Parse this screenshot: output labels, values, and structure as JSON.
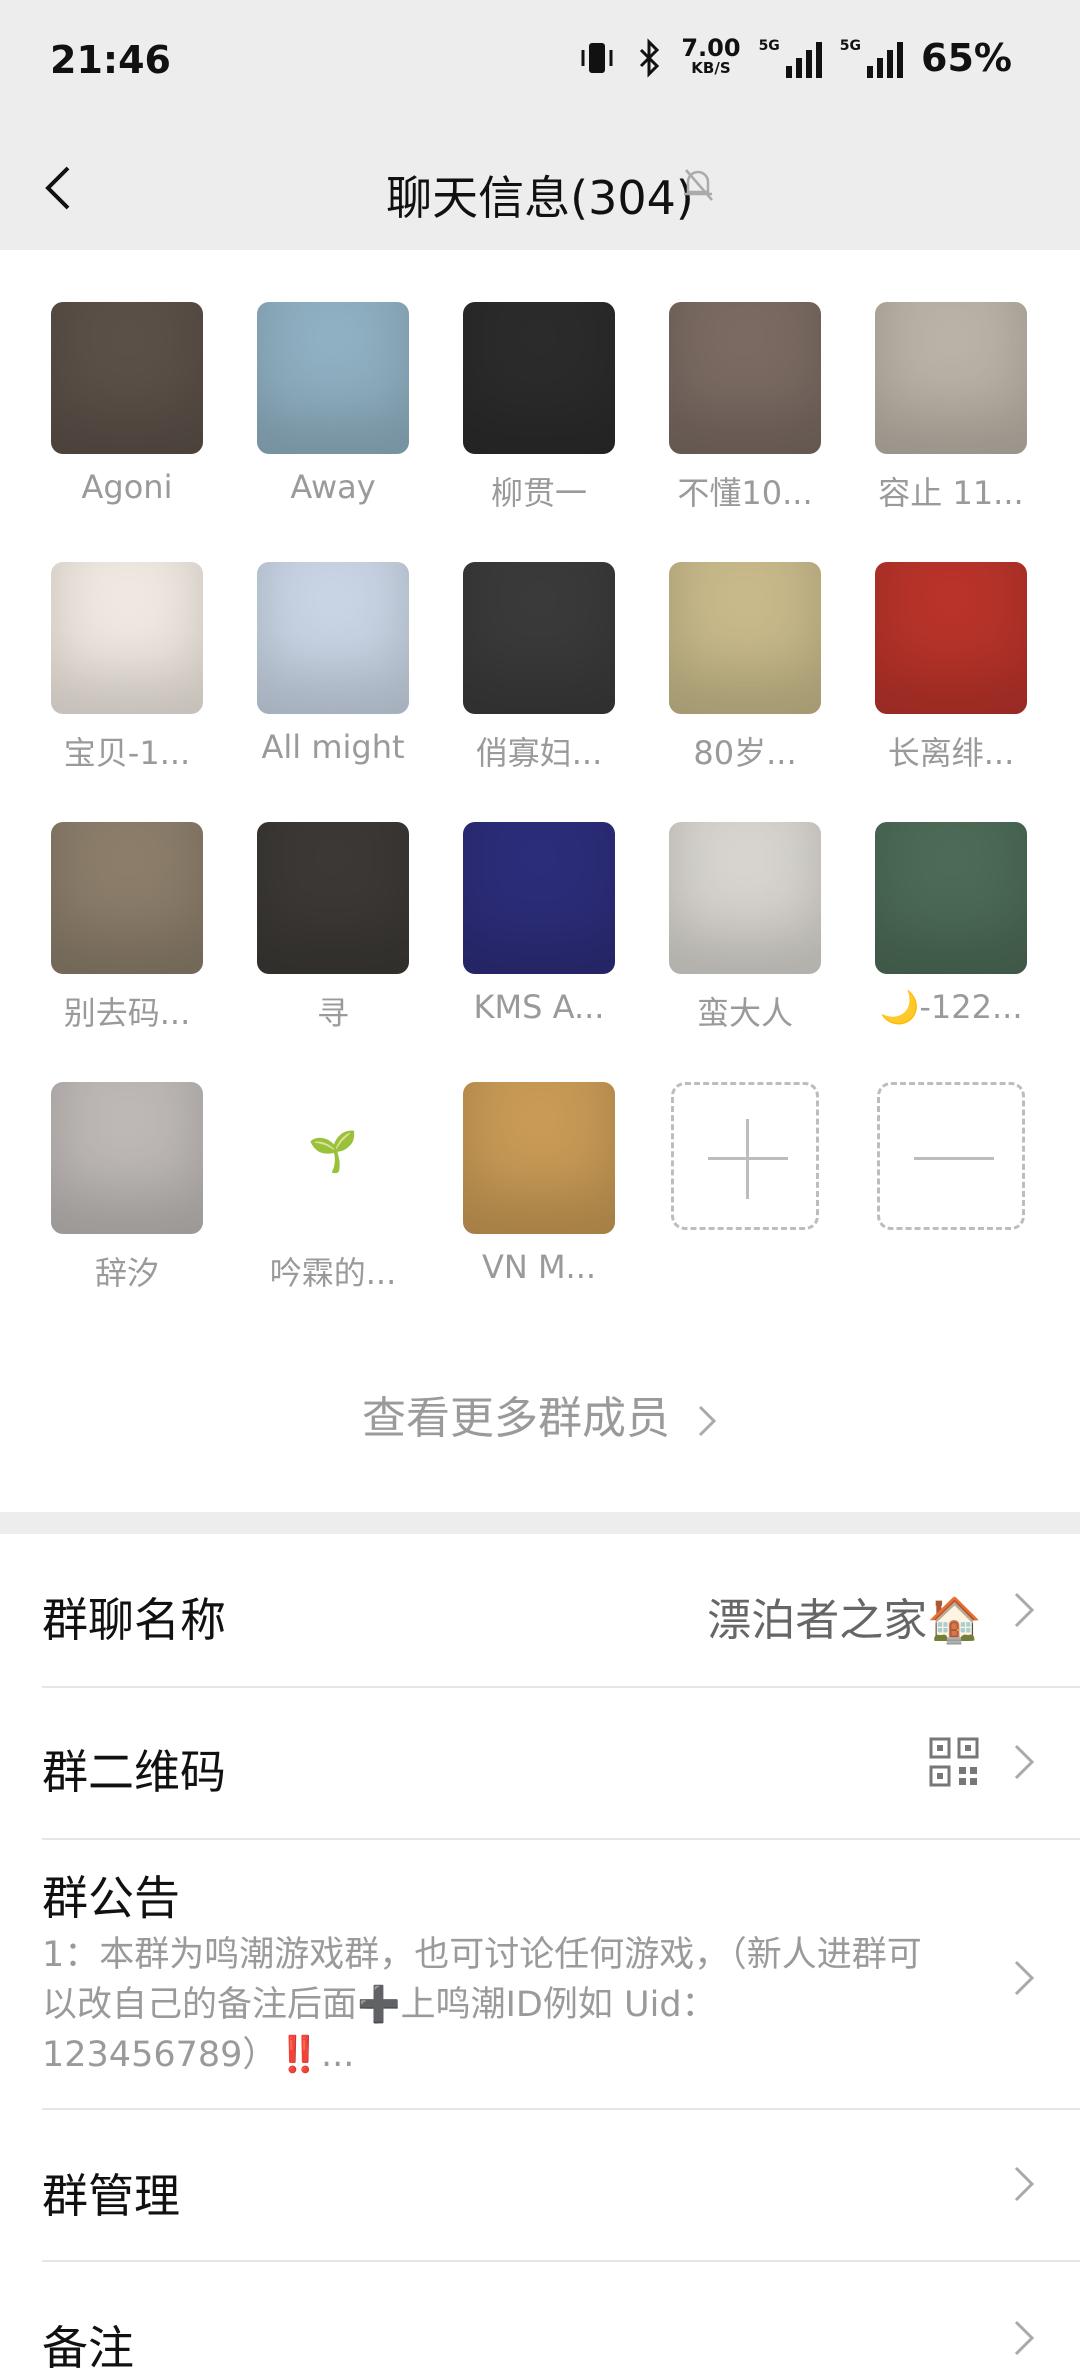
{
  "status_bar": {
    "time": "21:46",
    "net_speed_value": "7.00",
    "net_speed_unit": "KB/S",
    "signal_label": "5G",
    "battery": "65%"
  },
  "header": {
    "title": "聊天信息(304)"
  },
  "members": [
    {
      "name": "Agoni",
      "avatar_color": "#5b5048"
    },
    {
      "name": "Away",
      "avatar_color": "#8fb0c2"
    },
    {
      "name": "柳贯一",
      "avatar_color": "#2b2b2b"
    },
    {
      "name": "不懂10...",
      "avatar_color": "#7a6a62"
    },
    {
      "name": "容止 11...",
      "avatar_color": "#b9b2a6"
    },
    {
      "name": "宝贝-1...",
      "avatar_color": "#efe8e0"
    },
    {
      "name": "All might",
      "avatar_color": "#c8d4e4"
    },
    {
      "name": "俏寡妇...",
      "avatar_color": "#3a3a3a"
    },
    {
      "name": "80岁...",
      "avatar_color": "#c7b98a"
    },
    {
      "name": "长离绯...",
      "avatar_color": "#b8332a"
    },
    {
      "name": "别去码...",
      "avatar_color": "#8b7d6a"
    },
    {
      "name": "寻",
      "avatar_color": "#3b3835"
    },
    {
      "name": "KMS A...",
      "avatar_color": "#2c2d7a"
    },
    {
      "name": "蛮大人",
      "avatar_color": "#d7d4cf"
    },
    {
      "name": "🌙-122...",
      "avatar_color": "#4c6a57"
    },
    {
      "name": "辞汐",
      "avatar_color": "#bdb8b5"
    },
    {
      "name": "吟霖的...",
      "avatar_color": "#ffffff",
      "glyph": "🌱"
    },
    {
      "name": "VN M...",
      "avatar_color": "#c89a55"
    }
  ],
  "actions": {
    "more_members": "查看更多群成员"
  },
  "settings": {
    "group_name_label": "群聊名称",
    "group_name_value": "漂泊者之家🏠",
    "qr_label": "群二维码",
    "notice_label": "群公告",
    "notice_text": "1：本群为鸣潮游戏群，也可讨论任何游戏，（新人进群可以改自己的备注后面➕上鸣潮ID例如 Uid：123456789）‼️...",
    "manage_label": "群管理",
    "remark_label": "备注"
  },
  "icons": {
    "back": "chevron-left-icon",
    "mute": "bell-off-icon",
    "chevron": "chevron-right-icon",
    "qr": "qr-code-icon",
    "add": "plus-icon",
    "remove": "minus-icon"
  }
}
